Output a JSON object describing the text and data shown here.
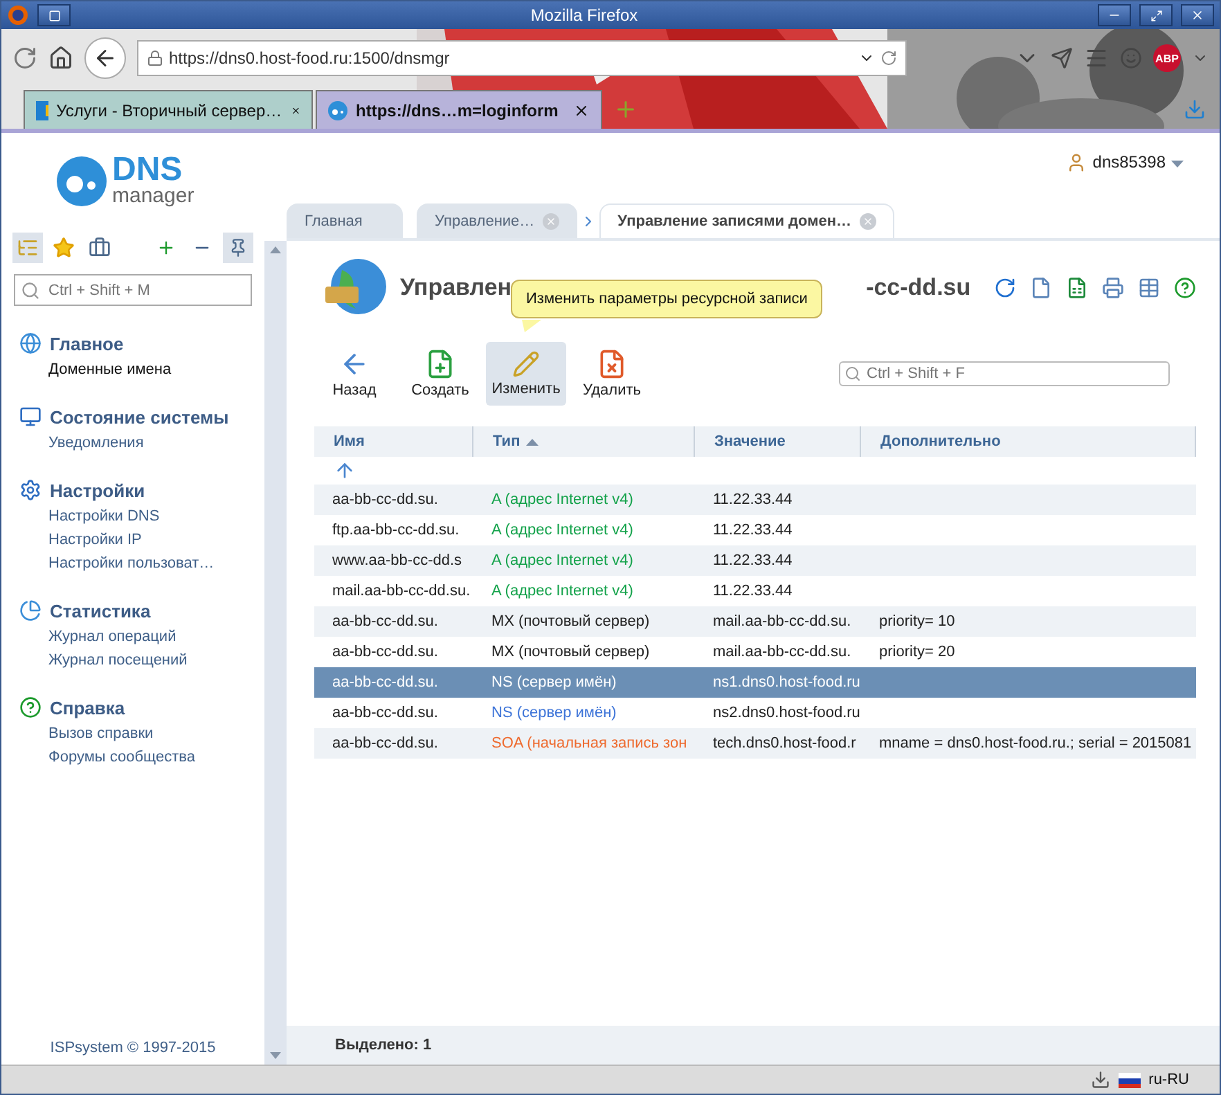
{
  "window": {
    "title": "Mozilla Firefox"
  },
  "browser": {
    "url": "https://dns0.host-food.ru:1500/dnsmgr",
    "adblock": "ABP",
    "tabs": [
      {
        "label": "Услуги - Вторичный сервер…",
        "kind": "hf",
        "selected": false
      },
      {
        "label": "https://dns…m=loginform",
        "kind": "dns",
        "selected": true
      }
    ]
  },
  "app": {
    "logo": {
      "name": "DNS",
      "sub": "manager"
    },
    "user": "dns85398"
  },
  "sidebar": {
    "toolbar": [
      {
        "kind": "tree",
        "selected": true
      },
      {
        "kind": "star",
        "selected": false
      },
      {
        "kind": "briefcase",
        "selected": false
      },
      {
        "kind": "expand",
        "selected": false
      },
      {
        "kind": "collapse",
        "selected": false
      },
      {
        "kind": "pin",
        "selected": true
      }
    ],
    "search": {
      "placeholder": "Ctrl + Shift + M"
    },
    "sections": [
      {
        "title": "Главное",
        "kind": "home",
        "items": [
          {
            "label": "Доменные имена",
            "selected": true
          }
        ]
      },
      {
        "title": "Состояние системы",
        "kind": "monitor",
        "items": [
          {
            "label": "Уведомления",
            "selected": false
          }
        ]
      },
      {
        "title": "Настройки",
        "kind": "settings",
        "items": [
          {
            "label": "Настройки DNS",
            "selected": false
          },
          {
            "label": "Настройки IP",
            "selected": false
          },
          {
            "label": "Настройки пользоват…",
            "selected": false
          }
        ]
      },
      {
        "title": "Статистика",
        "kind": "stats",
        "items": [
          {
            "label": "Журнал операций",
            "selected": false
          },
          {
            "label": "Журнал посещений",
            "selected": false
          }
        ]
      },
      {
        "title": "Справка",
        "kind": "help",
        "items": [
          {
            "label": "Вызов справки",
            "selected": false
          },
          {
            "label": "Форумы сообщества",
            "selected": false
          }
        ]
      }
    ],
    "copyright": "ISPsystem © 1997-2015"
  },
  "page_tabs": [
    {
      "label": "Главная",
      "closable": false,
      "selected": false
    },
    {
      "label": "Управление…",
      "closable": true,
      "selected": false
    },
    {
      "label": "Управление записями домен…",
      "closable": true,
      "selected": true
    }
  ],
  "content": {
    "title_start": "Управлен",
    "title_end": "-cc-dd.su",
    "tooltip": "Изменить параметры ресурсной записи",
    "actions": [
      {
        "kind": "refresh"
      },
      {
        "kind": "page"
      },
      {
        "kind": "excel"
      },
      {
        "kind": "print"
      },
      {
        "kind": "columns"
      },
      {
        "kind": "help"
      }
    ],
    "toolbar": [
      {
        "label": "Назад",
        "kind": "back",
        "hovered": false
      },
      {
        "label": "Создать",
        "kind": "create",
        "hovered": false
      },
      {
        "label": "Изменить",
        "kind": "edit",
        "hovered": true
      },
      {
        "label": "Удалить",
        "kind": "delete",
        "hovered": false
      }
    ],
    "filter": {
      "placeholder": "Ctrl + Shift + F"
    },
    "table": {
      "columns": [
        {
          "label": "Имя",
          "sorted": false
        },
        {
          "label": "Тип",
          "sorted": true
        },
        {
          "label": "Значение",
          "sorted": false
        },
        {
          "label": "Дополнительно",
          "sorted": false
        }
      ],
      "rows": [
        {
          "name": "aa-bb-cc-dd.su.",
          "type": "A (адрес Internet v4)",
          "color": "#13a24a",
          "value": "11.22.33.44",
          "extra": "",
          "selected": false
        },
        {
          "name": "ftp.aa-bb-cc-dd.su.",
          "type": "A (адрес Internet v4)",
          "color": "#13a24a",
          "value": "11.22.33.44",
          "extra": "",
          "selected": false
        },
        {
          "name": "www.aa-bb-cc-dd.s",
          "type": "A (адрес Internet v4)",
          "color": "#13a24a",
          "value": "11.22.33.44",
          "extra": "",
          "selected": false
        },
        {
          "name": "mail.aa-bb-cc-dd.su.",
          "type": "A (адрес Internet v4)",
          "color": "#13a24a",
          "value": "11.22.33.44",
          "extra": "",
          "selected": false
        },
        {
          "name": "aa-bb-cc-dd.su.",
          "type": "MX (почтовый сервер)",
          "color": "#222222",
          "value": "mail.aa-bb-cc-dd.su.",
          "extra": "priority= 10",
          "selected": false
        },
        {
          "name": "aa-bb-cc-dd.su.",
          "type": "MX (почтовый сервер)",
          "color": "#222222",
          "value": "mail.aa-bb-cc-dd.su.",
          "extra": "priority= 20",
          "selected": false
        },
        {
          "name": "aa-bb-cc-dd.su.",
          "type": "NS (сервер имён)",
          "value": "ns1.dns0.host-food.ru",
          "extra": "",
          "selected": true
        },
        {
          "name": "aa-bb-cc-dd.su.",
          "type": "NS (сервер имён)",
          "color": "#3d74d8",
          "value": "ns2.dns0.host-food.ru",
          "extra": "",
          "selected": false
        },
        {
          "name": "aa-bb-cc-dd.su.",
          "type": "SOA (начальная запись зон",
          "color": "#ee6a2e",
          "value": "tech.dns0.host-food.r",
          "extra": "mname = dns0.host-food.ru.; serial = 2015081",
          "selected": false
        }
      ]
    },
    "footer": "Выделено: 1"
  },
  "status_bar": {
    "locale": "ru-RU"
  }
}
